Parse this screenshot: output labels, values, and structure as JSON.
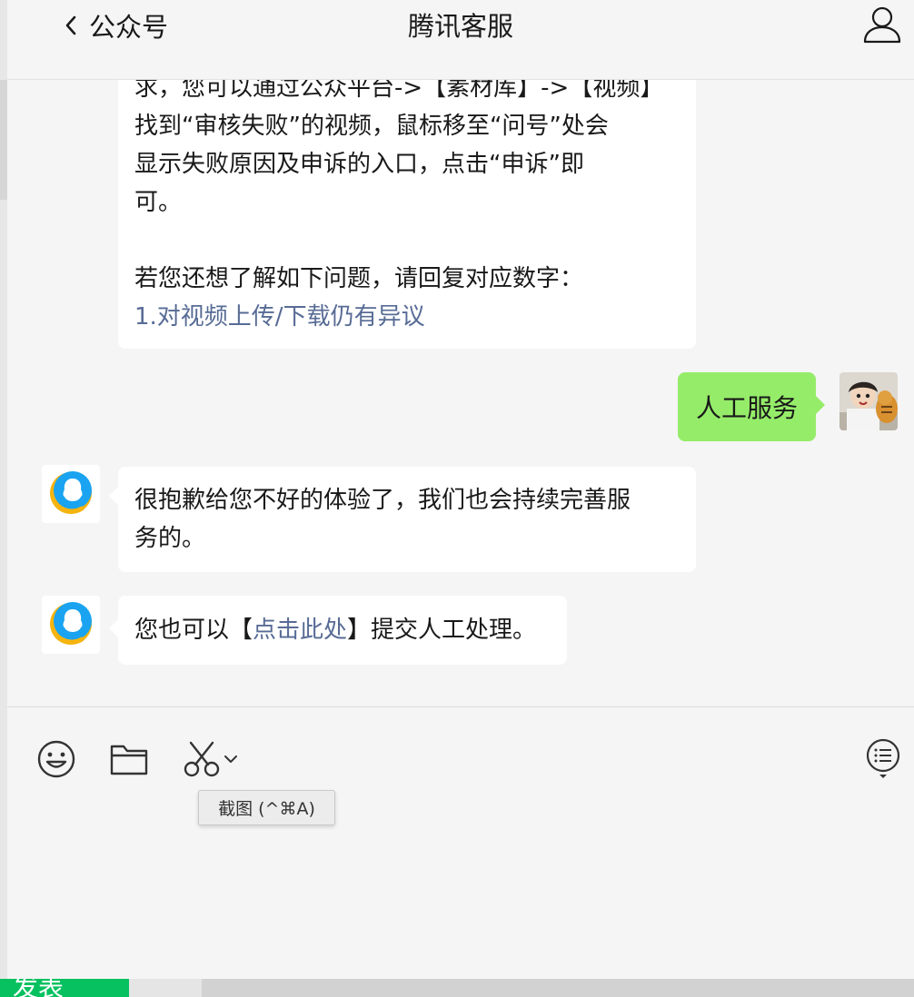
{
  "header": {
    "back_label": "公众号",
    "title": "腾讯客服"
  },
  "messages": {
    "m1": {
      "lines": [
        "求，您可以通过公众平台->【素材库】->【视频】",
        "找到“审核失败”的视频，鼠标移至“问号”处会",
        "显示失败原因及申诉的入口，点击“申诉”即",
        "可。"
      ],
      "prompt": "若您还想了解如下问题，请回复对应数字：",
      "option_link": "1.对视频上传/下载仍有异议"
    },
    "m2": {
      "text": "人工服务"
    },
    "m3": {
      "lines": [
        "很抱歉给您不好的体验了，我们也会持续完善服",
        "务的。"
      ]
    },
    "m4": {
      "before": "您也可以【",
      "link": "点击此处",
      "after": "】提交人工处理。"
    }
  },
  "toolbar": {
    "tooltip": "截图 (^⌘A)"
  },
  "bottom": {
    "button_label": "发表"
  },
  "colors": {
    "accent_green": "#95ec69",
    "link": "#576b95",
    "brand_green": "#07c160"
  },
  "icons": [
    "back-chevron-icon",
    "profile-icon",
    "emoji-icon",
    "folder-icon",
    "scissors-icon",
    "chevron-down-icon",
    "chat-history-icon"
  ]
}
